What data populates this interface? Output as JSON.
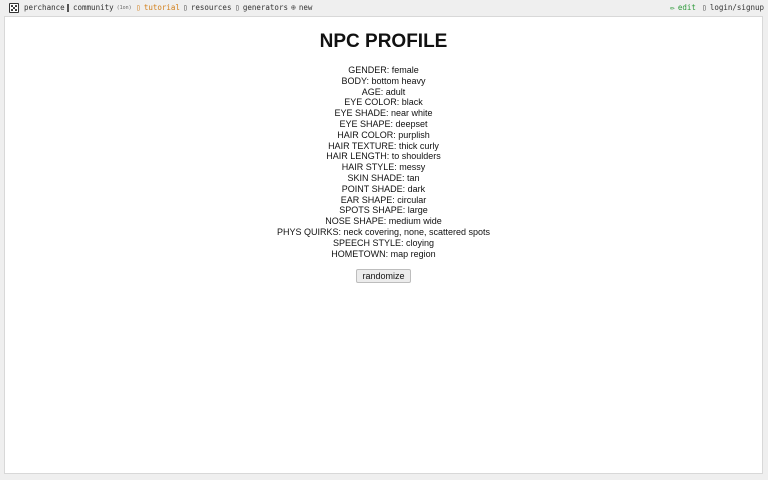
{
  "nav": {
    "brand": "perchance",
    "community": "community",
    "community_badge": "(1on)",
    "tutorial": "tutorial",
    "resources": "resources",
    "generators": "generators",
    "new": "new",
    "edit": "edit",
    "login": "login/signup",
    "colors": {
      "accent": "#d27f1a",
      "edit": "#2e9a3a"
    }
  },
  "profile": {
    "title": "NPC PROFILE",
    "fields": [
      {
        "label": "GENDER:",
        "value": "female"
      },
      {
        "label": "BODY:",
        "value": "bottom heavy"
      },
      {
        "label": "AGE:",
        "value": "adult"
      },
      {
        "label": "EYE COLOR:",
        "value": "black"
      },
      {
        "label": "EYE SHADE:",
        "value": "near white"
      },
      {
        "label": "EYE SHAPE:",
        "value": "deepset"
      },
      {
        "label": "HAIR COLOR:",
        "value": "purplish"
      },
      {
        "label": "HAIR TEXTURE:",
        "value": "thick curly"
      },
      {
        "label": "HAIR LENGTH:",
        "value": "to shoulders"
      },
      {
        "label": "HAIR STYLE:",
        "value": "messy"
      },
      {
        "label": "SKIN SHADE:",
        "value": "tan"
      },
      {
        "label": "POINT SHADE:",
        "value": "dark"
      },
      {
        "label": "EAR SHAPE:",
        "value": "circular"
      },
      {
        "label": "SPOTS SHAPE:",
        "value": "large"
      },
      {
        "label": "NOSE SHAPE:",
        "value": "medium wide"
      },
      {
        "label": "PHYS QUIRKS:",
        "value": "neck covering, none, scattered spots"
      },
      {
        "label": "SPEECH STYLE:",
        "value": "cloying"
      },
      {
        "label": "HOMETOWN:",
        "value": "map region"
      }
    ],
    "randomize_label": "randomize"
  }
}
